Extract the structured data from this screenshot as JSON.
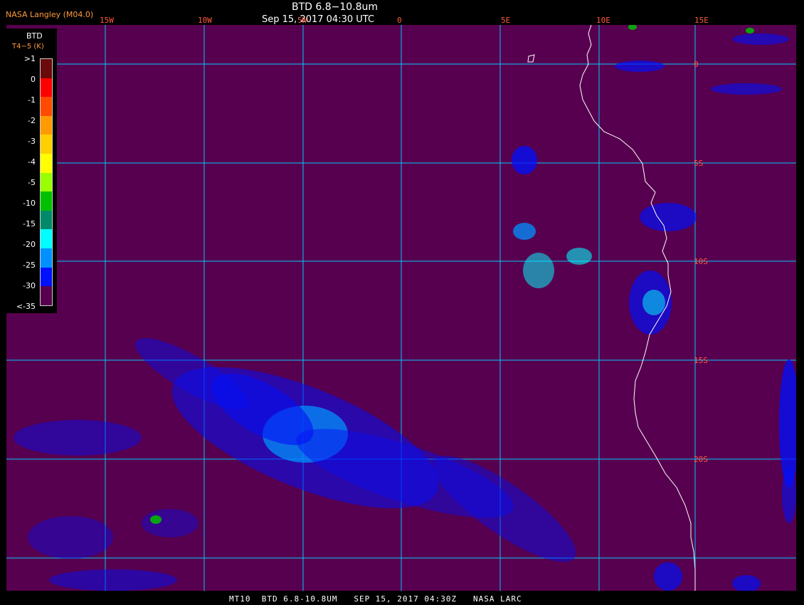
{
  "header": {
    "agency": "NASA Langley (M04.0)",
    "title": "BTD 6.8−10.8um",
    "subtitle": "Sep 15, 2017 04:30 UTC"
  },
  "longitude_labels": [
    "15W",
    "10W",
    "5W",
    "0",
    "5E",
    "10E",
    "15E"
  ],
  "latitude_labels": [
    "0",
    "5S",
    "10S",
    "15S",
    "20S"
  ],
  "legend": {
    "title": "BTD",
    "units": "T4−5 (K)",
    "entries": [
      {
        "label": ">1",
        "color": "#6a0a0a"
      },
      {
        "label": "0",
        "color": "#ff0000"
      },
      {
        "label": "-1",
        "color": "#ff4a00"
      },
      {
        "label": "-2",
        "color": "#ff9a00"
      },
      {
        "label": "-3",
        "color": "#ffd000"
      },
      {
        "label": "-4",
        "color": "#ffff00"
      },
      {
        "label": "-5",
        "color": "#9aff00"
      },
      {
        "label": "-10",
        "color": "#00c000"
      },
      {
        "label": "-15",
        "color": "#008a6a"
      },
      {
        "label": "-20",
        "color": "#00ffff"
      },
      {
        "label": "-25",
        "color": "#0090ff"
      },
      {
        "label": "-30",
        "color": "#0010ff"
      },
      {
        "label": "<-35",
        "color": "#57004f"
      }
    ]
  },
  "colors": {
    "background": "#57004f",
    "grid": "#00c8ff",
    "coastline": "#ffffff"
  },
  "footer": "MT10  BTD 6.8-10.8UM   SEP 15, 2017 04:30Z   NASA LARC"
}
